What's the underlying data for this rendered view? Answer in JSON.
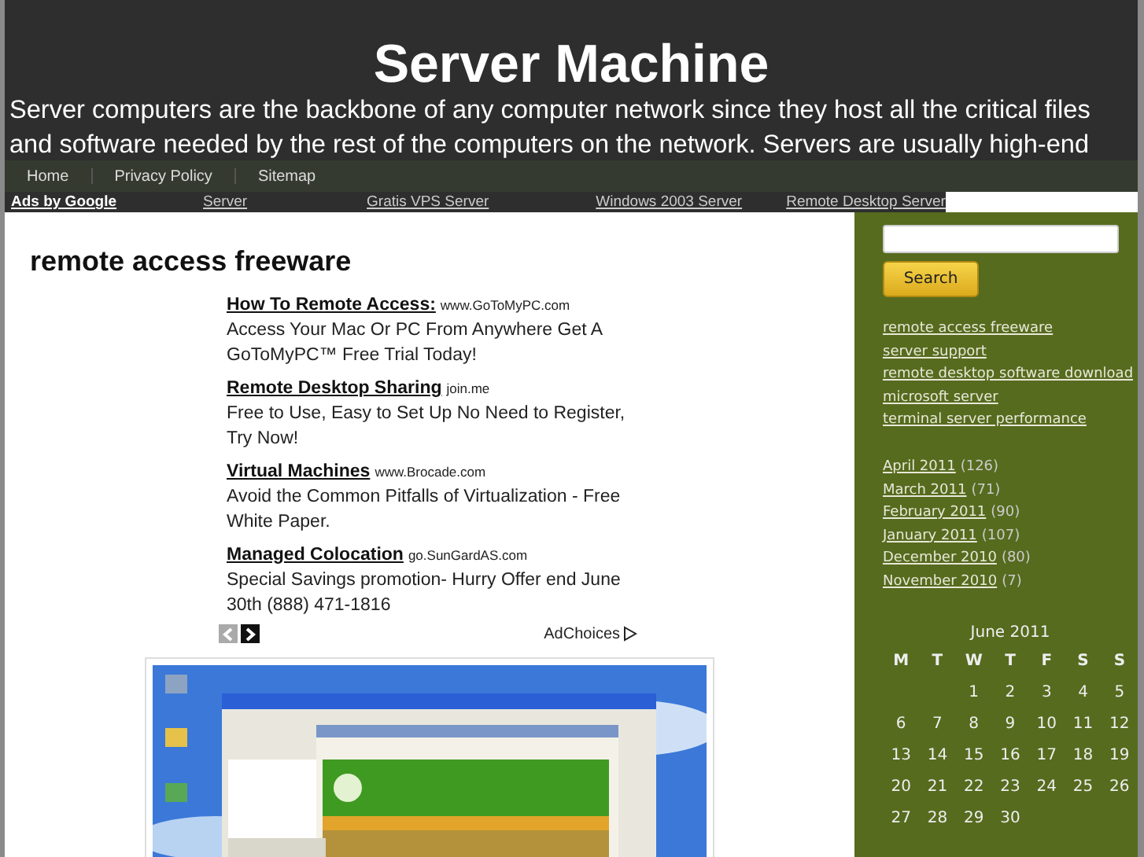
{
  "header": {
    "title": "Server Machine",
    "description": "Server computers are the backbone of any computer network since they host all the critical files and software needed by the rest of the computers on the network. Servers are usually high-end"
  },
  "nav": [
    "Home",
    "Privacy Policy",
    "Sitemap"
  ],
  "ads_bar": {
    "label": "Ads by Google",
    "links": [
      "Server",
      "Gratis VPS Server",
      "Windows 2003 Server",
      "Remote Desktop Server"
    ]
  },
  "main": {
    "heading": "remote access freeware",
    "ads": [
      {
        "title": "How To Remote Access:",
        "domain": "www.GoToMyPC.com",
        "text": "Access Your Mac Or PC From Anywhere Get A GoToMyPC™ Free Trial Today!"
      },
      {
        "title": "Remote Desktop Sharing",
        "domain": "join.me",
        "text": "Free to Use, Easy to Set Up No Need to Register, Try Now!"
      },
      {
        "title": "Virtual Machines",
        "domain": "www.Brocade.com",
        "text": "Avoid the Common Pitfalls of Virtualization - Free White Paper."
      },
      {
        "title": "Managed Colocation",
        "domain": "go.SunGardAS.com",
        "text": "Special Savings promotion- Hurry Offer end June 30th (888) 471-1816"
      }
    ],
    "pager": [
      {
        "disabled": true
      },
      {
        "disabled": false
      }
    ],
    "adchoices": "AdChoices"
  },
  "sidebar": {
    "search_button": "Search",
    "links": [
      "remote access freeware",
      "server support",
      "remote desktop software download",
      "microsoft server",
      "terminal server performance"
    ],
    "archives": [
      {
        "month": "April 2011",
        "count": "(126)"
      },
      {
        "month": "March 2011",
        "count": "(71)"
      },
      {
        "month": "February 2011",
        "count": "(90)"
      },
      {
        "month": "January 2011",
        "count": "(107)"
      },
      {
        "month": "December 2010",
        "count": "(80)"
      },
      {
        "month": "November 2010",
        "count": "(7)"
      }
    ],
    "calendar": {
      "caption": "June 2011",
      "weekdays": [
        "M",
        "T",
        "W",
        "T",
        "F",
        "S",
        "S"
      ],
      "weeks": [
        [
          "1",
          "2",
          "3",
          "4",
          "5"
        ],
        [
          "6",
          "7",
          "8",
          "9",
          "10",
          "11",
          "12"
        ],
        [
          "13",
          "14",
          "15",
          "16",
          "17",
          "18",
          "19"
        ],
        [
          "20",
          "21",
          "22",
          "23",
          "24",
          "25",
          "26"
        ],
        [
          "27",
          "28",
          "29",
          "30"
        ]
      ]
    }
  }
}
